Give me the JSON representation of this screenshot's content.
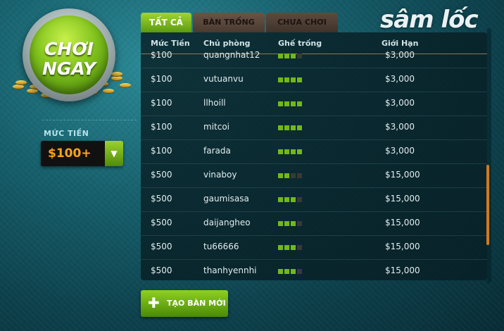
{
  "play_button": {
    "line1": "CHƠI",
    "line2": "NGAY"
  },
  "money_filter": {
    "label": "MỨC TIỀN",
    "selected": "$100+"
  },
  "logo": "sâm lốc",
  "tabs": [
    {
      "label": "TẤT CẢ",
      "active": true
    },
    {
      "label": "BÀN TRỐNG",
      "active": false
    },
    {
      "label": "CHƯA CHƠI",
      "active": false
    }
  ],
  "table": {
    "headers": {
      "money": "Mức Tiền",
      "owner": "Chủ phòng",
      "seats": "Ghế trống",
      "limit": "Giới Hạn"
    },
    "rows": [
      {
        "money": "$100",
        "owner": "quangnhat12",
        "seats_filled": 3,
        "seats_total": 4,
        "limit": "$3,000"
      },
      {
        "money": "$100",
        "owner": "vutuanvu",
        "seats_filled": 4,
        "seats_total": 4,
        "limit": "$3,000"
      },
      {
        "money": "$100",
        "owner": "llhoill",
        "seats_filled": 4,
        "seats_total": 4,
        "limit": "$3,000"
      },
      {
        "money": "$100",
        "owner": "mitcoi",
        "seats_filled": 4,
        "seats_total": 4,
        "limit": "$3,000"
      },
      {
        "money": "$100",
        "owner": "farada",
        "seats_filled": 4,
        "seats_total": 4,
        "limit": "$3,000"
      },
      {
        "money": "$500",
        "owner": "vinaboy",
        "seats_filled": 2,
        "seats_total": 4,
        "limit": "$15,000"
      },
      {
        "money": "$500",
        "owner": "gaumisasa",
        "seats_filled": 3,
        "seats_total": 4,
        "limit": "$15,000"
      },
      {
        "money": "$500",
        "owner": "daijangheo",
        "seats_filled": 3,
        "seats_total": 4,
        "limit": "$15,000"
      },
      {
        "money": "$500",
        "owner": "tu66666",
        "seats_filled": 3,
        "seats_total": 4,
        "limit": "$15,000"
      },
      {
        "money": "$500",
        "owner": "thanhyennhi",
        "seats_filled": 3,
        "seats_total": 4,
        "limit": "$15,000"
      }
    ]
  },
  "new_table_button": {
    "label": "TẠO BÀN MỚI",
    "icon": "plus-icon"
  },
  "colors": {
    "accent_green": "#7fc11c",
    "money_orange": "#ffa21a",
    "scroll_orange": "#d07a20"
  }
}
